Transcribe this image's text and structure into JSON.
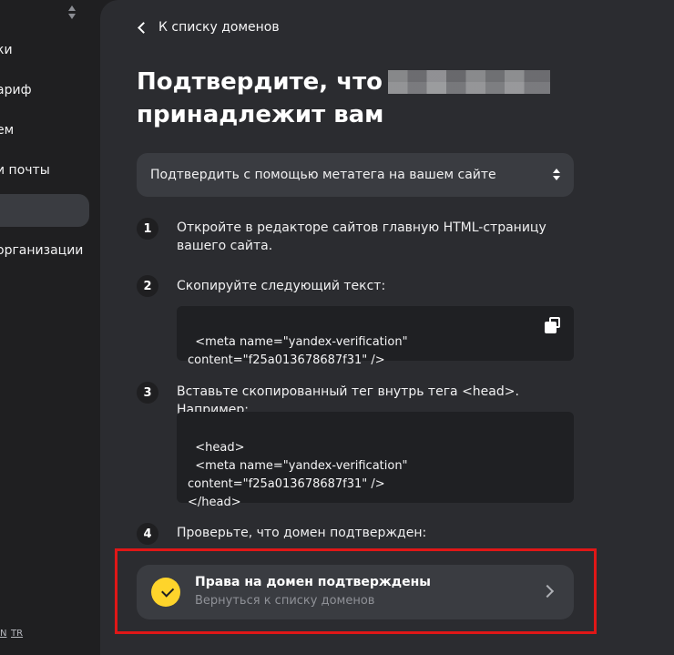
{
  "sidebar": {
    "items": [
      {
        "label": "ки"
      },
      {
        "label": "ариф"
      },
      {
        "label": "ем"
      },
      {
        "label": "и почты"
      },
      {
        "label": ""
      },
      {
        "label": "организации"
      }
    ],
    "lang": [
      "N",
      "TR"
    ]
  },
  "header": {
    "back_label": "К списку доменов"
  },
  "title": {
    "line1": "Подтвердите, что",
    "line2": "принадлежит вам"
  },
  "method_select": {
    "value": "Подтвердить с помощью метатега на вашем сайте"
  },
  "steps": [
    {
      "num": "1",
      "text": "Откройте в редакторе сайтов главную HTML-страницу вашего сайта."
    },
    {
      "num": "2",
      "text": "Скопируйте следующий текст:"
    },
    {
      "num": "3",
      "text": "Вставьте скопированный тег внутрь тега <head>. Например:"
    },
    {
      "num": "4",
      "text": "Проверьте, что домен подтвержден:"
    }
  ],
  "code1": "<meta name=\"yandex-verification\"\ncontent=\"f25a013678687f31\" />",
  "code2": "<head>\n  <meta name=\"yandex-verification\"\ncontent=\"f25a013678687f31\" />\n</head>",
  "confirm": {
    "title": "Права на домен подтверждены",
    "subtitle": "Вернуться к списку доменов"
  },
  "colors": {
    "accent": "#fed42b",
    "highlight": "#e01717",
    "panel": "#2b2c30",
    "sidebar": "#1f1f21"
  }
}
